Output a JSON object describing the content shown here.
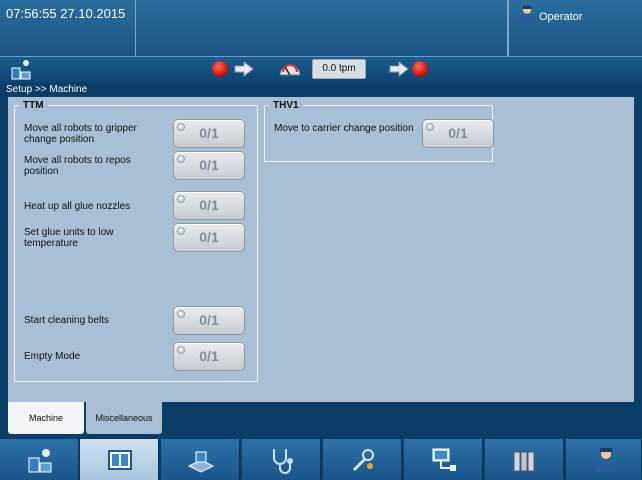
{
  "header": {
    "datetime": "07:56:55 27.10.2015",
    "user_label": "Operator"
  },
  "statusbar": {
    "speed": "0.0 tpm"
  },
  "breadcrumb": "Setup >> Machine",
  "groups": {
    "ttm": {
      "title": "TTM",
      "rows": [
        {
          "label": "Move all robots to gripper change position",
          "button": "0/1"
        },
        {
          "label": "Move all robots to repos position",
          "button": "0/1"
        },
        {
          "label": "Heat up all glue nozzles",
          "button": "0/1"
        },
        {
          "label": "Set glue units to low temperature",
          "button": "0/1"
        },
        {
          "label": "Start cleaning belts",
          "button": "0/1"
        },
        {
          "label": "Empty Mode",
          "button": "0/1"
        }
      ]
    },
    "thv1": {
      "title": "THV1",
      "rows": [
        {
          "label": "Move to carrier change position",
          "button": "0/1"
        }
      ]
    }
  },
  "tabs": [
    "Machine",
    "Miscellaneous"
  ],
  "nav": [
    "machine-icon",
    "layout-icon",
    "conveyor-icon",
    "stethoscope-icon",
    "tools-icon",
    "network-icon",
    "binders-icon",
    "user-icon"
  ]
}
